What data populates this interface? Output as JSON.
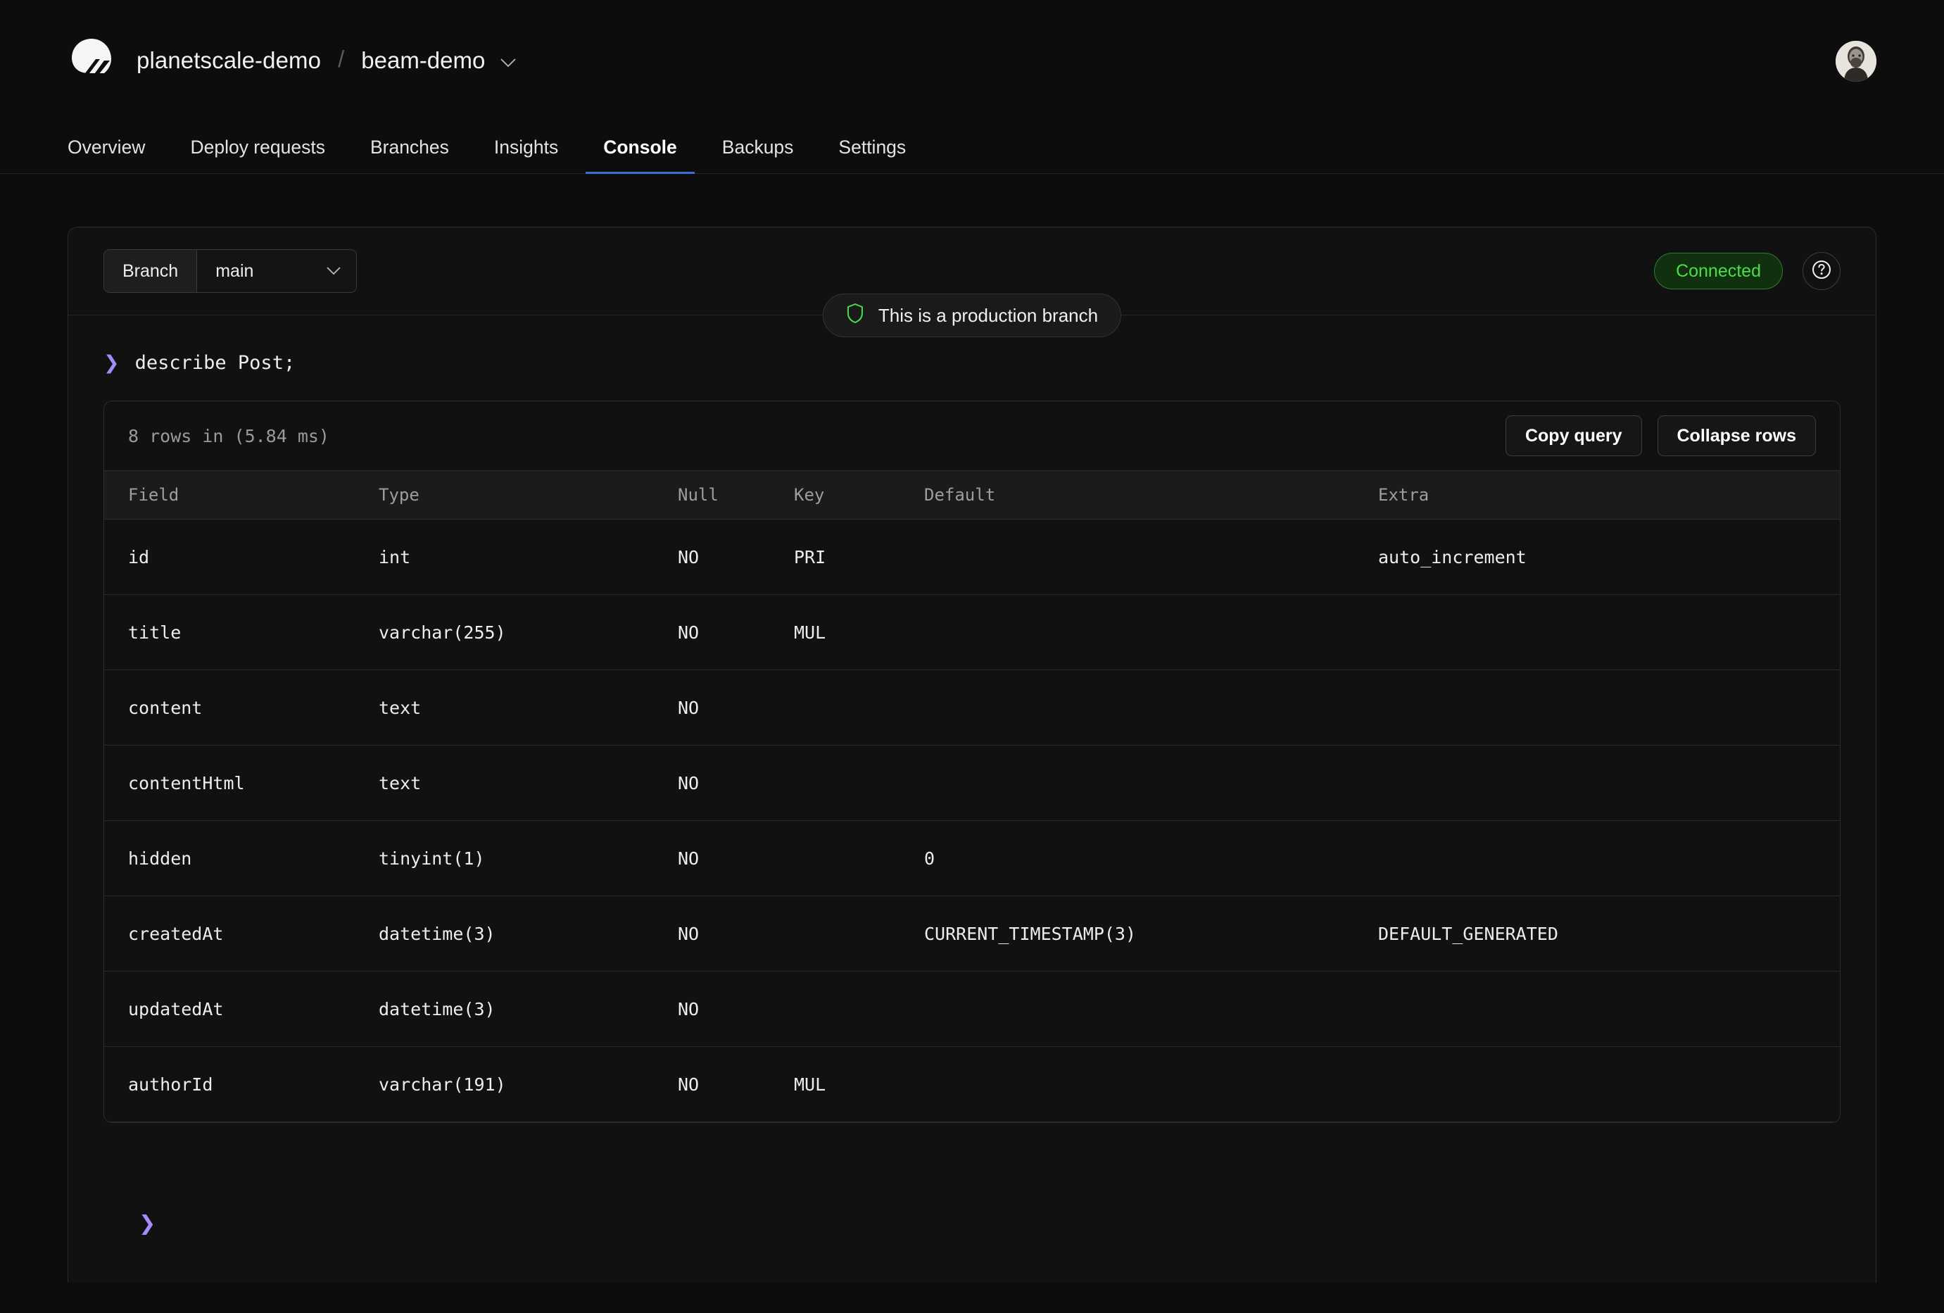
{
  "header": {
    "org": "planetscale-demo",
    "separator": "/",
    "database": "beam-demo",
    "db_chevron_icon": "chevron-down-icon",
    "logo_icon": "planetscale-logo",
    "avatar_icon": "user-avatar"
  },
  "nav": {
    "tabs": [
      {
        "label": "Overview",
        "active": false
      },
      {
        "label": "Deploy requests",
        "active": false
      },
      {
        "label": "Branches",
        "active": false
      },
      {
        "label": "Insights",
        "active": false
      },
      {
        "label": "Console",
        "active": true
      },
      {
        "label": "Backups",
        "active": false
      },
      {
        "label": "Settings",
        "active": false
      }
    ],
    "active_underline_color": "#3b6fd4"
  },
  "console": {
    "branch": {
      "label": "Branch",
      "value": "main",
      "chevron_icon": "chevron-down-icon"
    },
    "status_badge": {
      "label": "Connected",
      "color": "#4ade4a",
      "border_color": "#2f7d32",
      "background": "#11300f"
    },
    "help_button": {
      "icon": "question-mark-circle-icon",
      "label": "?"
    },
    "production_notice": {
      "icon": "shield-icon",
      "icon_color": "#4ade4a",
      "text": "This is a production branch"
    },
    "query": {
      "prompt": "❯",
      "prompt_color": "#a78bfa",
      "text": "describe Post;"
    },
    "results": {
      "rows_info": "8 rows in (5.84 ms)",
      "actions": [
        {
          "label": "Copy query"
        },
        {
          "label": "Collapse rows"
        }
      ],
      "columns": [
        "Field",
        "Type",
        "Null",
        "Key",
        "Default",
        "Extra"
      ],
      "rows": [
        {
          "field": "id",
          "type": "int",
          "null": "NO",
          "key": "PRI",
          "default": "",
          "extra": "auto_increment"
        },
        {
          "field": "title",
          "type": "varchar(255)",
          "null": "NO",
          "key": "MUL",
          "default": "",
          "extra": ""
        },
        {
          "field": "content",
          "type": "text",
          "null": "NO",
          "key": "",
          "default": "",
          "extra": ""
        },
        {
          "field": "contentHtml",
          "type": "text",
          "null": "NO",
          "key": "",
          "default": "",
          "extra": ""
        },
        {
          "field": "hidden",
          "type": "tinyint(1)",
          "null": "NO",
          "key": "",
          "default": "0",
          "extra": ""
        },
        {
          "field": "createdAt",
          "type": "datetime(3)",
          "null": "NO",
          "key": "",
          "default": "CURRENT_TIMESTAMP(3)",
          "extra": "DEFAULT_GENERATED"
        },
        {
          "field": "updatedAt",
          "type": "datetime(3)",
          "null": "NO",
          "key": "",
          "default": "",
          "extra": ""
        },
        {
          "field": "authorId",
          "type": "varchar(191)",
          "null": "NO",
          "key": "MUL",
          "default": "",
          "extra": ""
        }
      ]
    },
    "next_prompt": {
      "prompt": "❯",
      "placeholder": ""
    }
  }
}
